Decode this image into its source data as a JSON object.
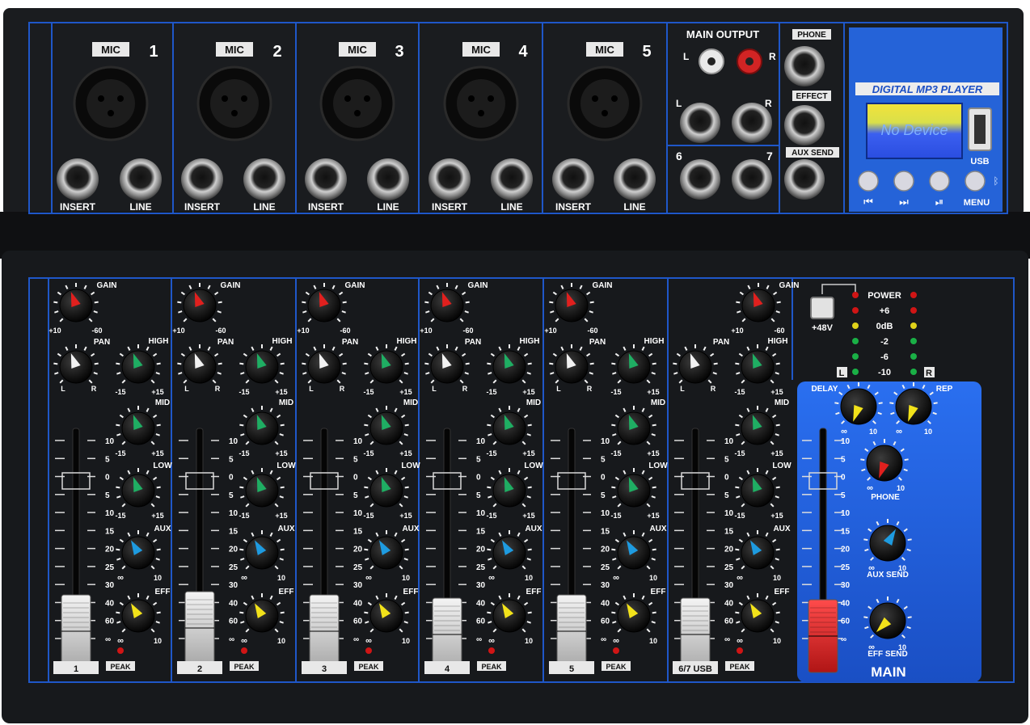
{
  "top": {
    "channels": [
      {
        "mic_label": "MIC",
        "number": "1",
        "insert_label": "INSERT",
        "line_label": "LINE"
      },
      {
        "mic_label": "MIC",
        "number": "2",
        "insert_label": "INSERT",
        "line_label": "LINE"
      },
      {
        "mic_label": "MIC",
        "number": "3",
        "insert_label": "INSERT",
        "line_label": "LINE"
      },
      {
        "mic_label": "MIC",
        "number": "4",
        "insert_label": "INSERT",
        "line_label": "LINE"
      },
      {
        "mic_label": "MIC",
        "number": "5",
        "insert_label": "INSERT",
        "line_label": "LINE"
      }
    ],
    "main_output": {
      "title": "MAIN OUTPUT",
      "left": "L",
      "right": "R",
      "left2": "L",
      "right2": "R",
      "ch6": "6",
      "ch7": "7"
    },
    "sends": {
      "phone": "PHONE",
      "effect": "EFFECT",
      "aux_send": "AUX SEND"
    },
    "mp3": {
      "title": "DIGITAL MP3 PLAYER",
      "display": "No Device",
      "usb": "USB",
      "prev": "⏮",
      "next": "⏭",
      "play": "⏯",
      "menu": "MENU"
    }
  },
  "strip": {
    "labels": {
      "gain": "GAIN",
      "pan": "PAN",
      "high": "HIGH",
      "mid": "MID",
      "low": "LOW",
      "aux": "AUX",
      "eff": "EFF",
      "peak": "PEAK",
      "gain_min": "+10",
      "gain_max": "-60",
      "pan_l": "L",
      "pan_r": "R",
      "eq_min": "-15",
      "eq_max": "+15",
      "send_min": "∞",
      "send_max": "10"
    },
    "fader_scale": [
      "10",
      "5",
      "0",
      "5",
      "10",
      "15",
      "20",
      "25",
      "30",
      "40",
      "60",
      "∞"
    ],
    "channel_numbers": [
      "1",
      "2",
      "3",
      "4",
      "5",
      "6/7 USB"
    ]
  },
  "meter": {
    "labels": [
      "POWER",
      "+6",
      "0dB",
      "-2",
      "-6",
      "-10"
    ],
    "left": "L",
    "right": "R",
    "phantom": "+48V"
  },
  "main": {
    "delay": "DELAY",
    "rep": "REP",
    "phone": "PHONE",
    "aux_send": "AUX SEND",
    "eff_send": "EFF SEND",
    "title": "MAIN",
    "min": "∞",
    "max": "10"
  },
  "colors": {
    "panel": "#17191c",
    "blue_line": "#1f57c8",
    "blue_panel": "#1c5fdc",
    "gain_knob": "#e0201e",
    "eq_knob": "#1fae63",
    "aux_knob": "#1e9be0",
    "eff_knob": "#f2e21a",
    "pan_knob": "#f2f2f2",
    "main_fader": "#e3262a"
  }
}
